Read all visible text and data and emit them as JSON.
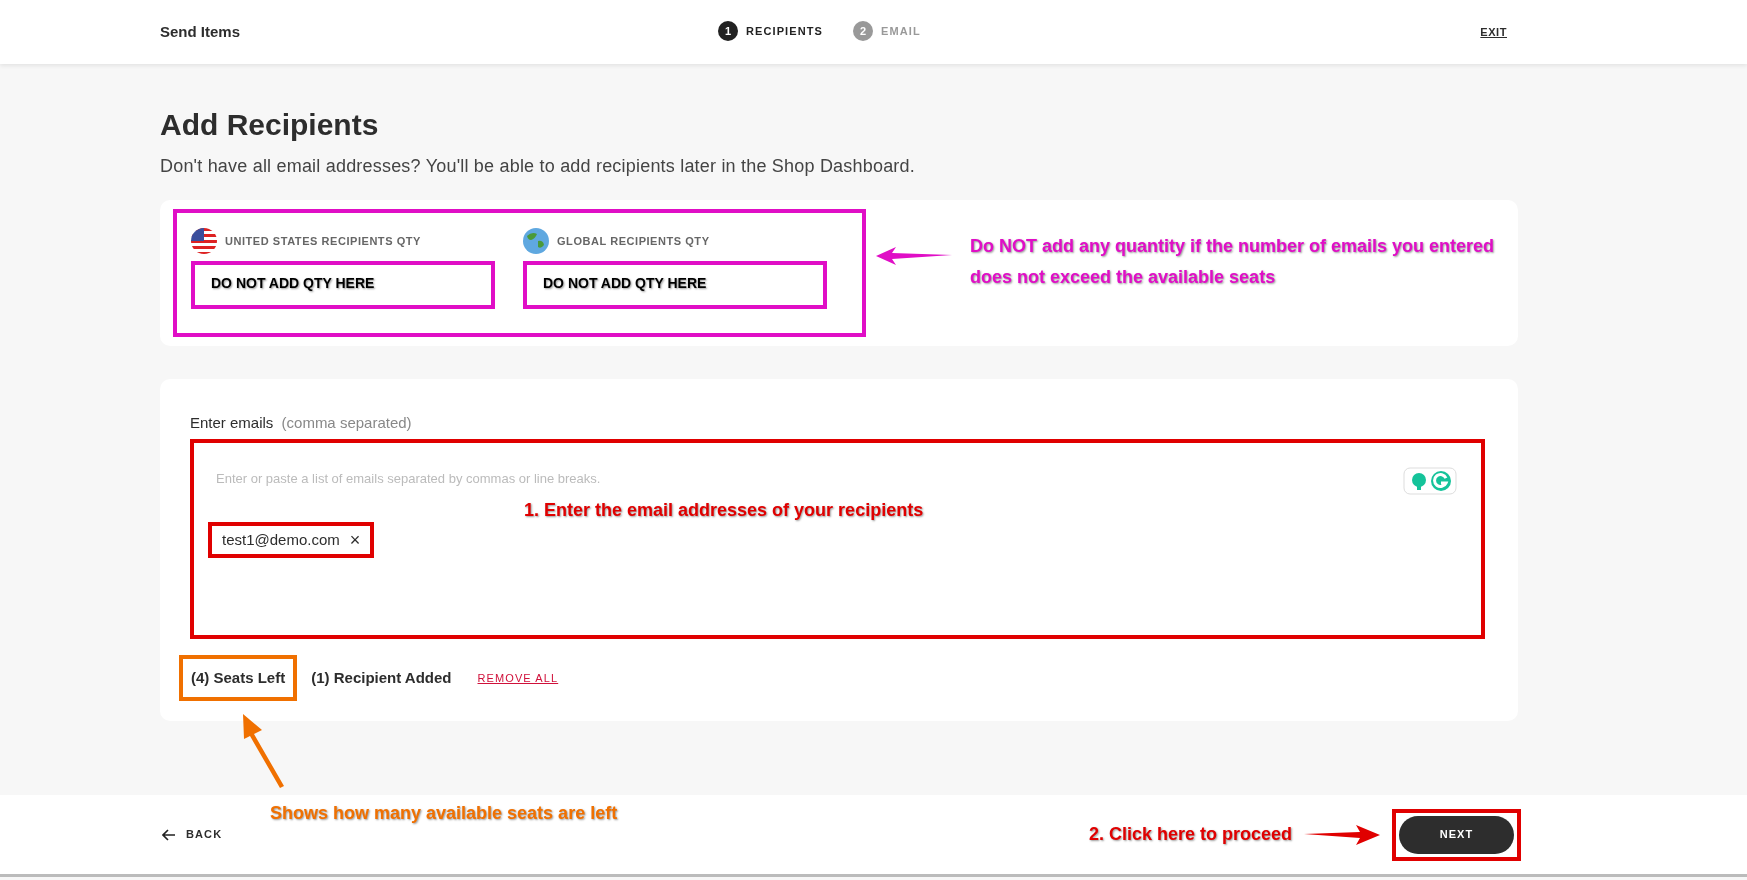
{
  "header": {
    "title": "Send Items",
    "exit": "EXIT",
    "steps": [
      {
        "number": "1",
        "label": "RECIPIENTS",
        "selected": true
      },
      {
        "number": "2",
        "label": "EMAIL",
        "selected": false
      }
    ]
  },
  "heading": "Add Recipients",
  "subtitle": "Don't have all email addresses? You'll be able to add recipients later in the Shop Dashboard.",
  "quantity": {
    "fields": [
      {
        "kind": "us",
        "label": "UNITED STATES RECIPIENTS QTY",
        "note": "DO NOT ADD QTY HERE"
      },
      {
        "kind": "global",
        "label": "GLOBAL RECIPIENTS QTY",
        "note": "DO NOT ADD QTY HERE"
      }
    ],
    "note_lines": [
      "Do NOT add any quantity if the number of emails you entered",
      "does not exceed the available seats"
    ]
  },
  "emails": {
    "label": "Enter emails",
    "hint": "(comma separated)",
    "placeholder": "Enter or paste a list of emails separated by commas or line breaks.",
    "chips": [
      {
        "text": "test1@demo.com",
        "remove": "×"
      }
    ],
    "note": "1. Enter the email addresses of your recipients"
  },
  "summary": {
    "seats_left": "(4) Seats Left",
    "recipients_added": "(1) Recipient Added",
    "remove_all": "REMOVE ALL",
    "note": "Shows how many available seats are left"
  },
  "footer": {
    "back": "BACK",
    "next": "NEXT",
    "note": "2. Click here to proceed"
  }
}
